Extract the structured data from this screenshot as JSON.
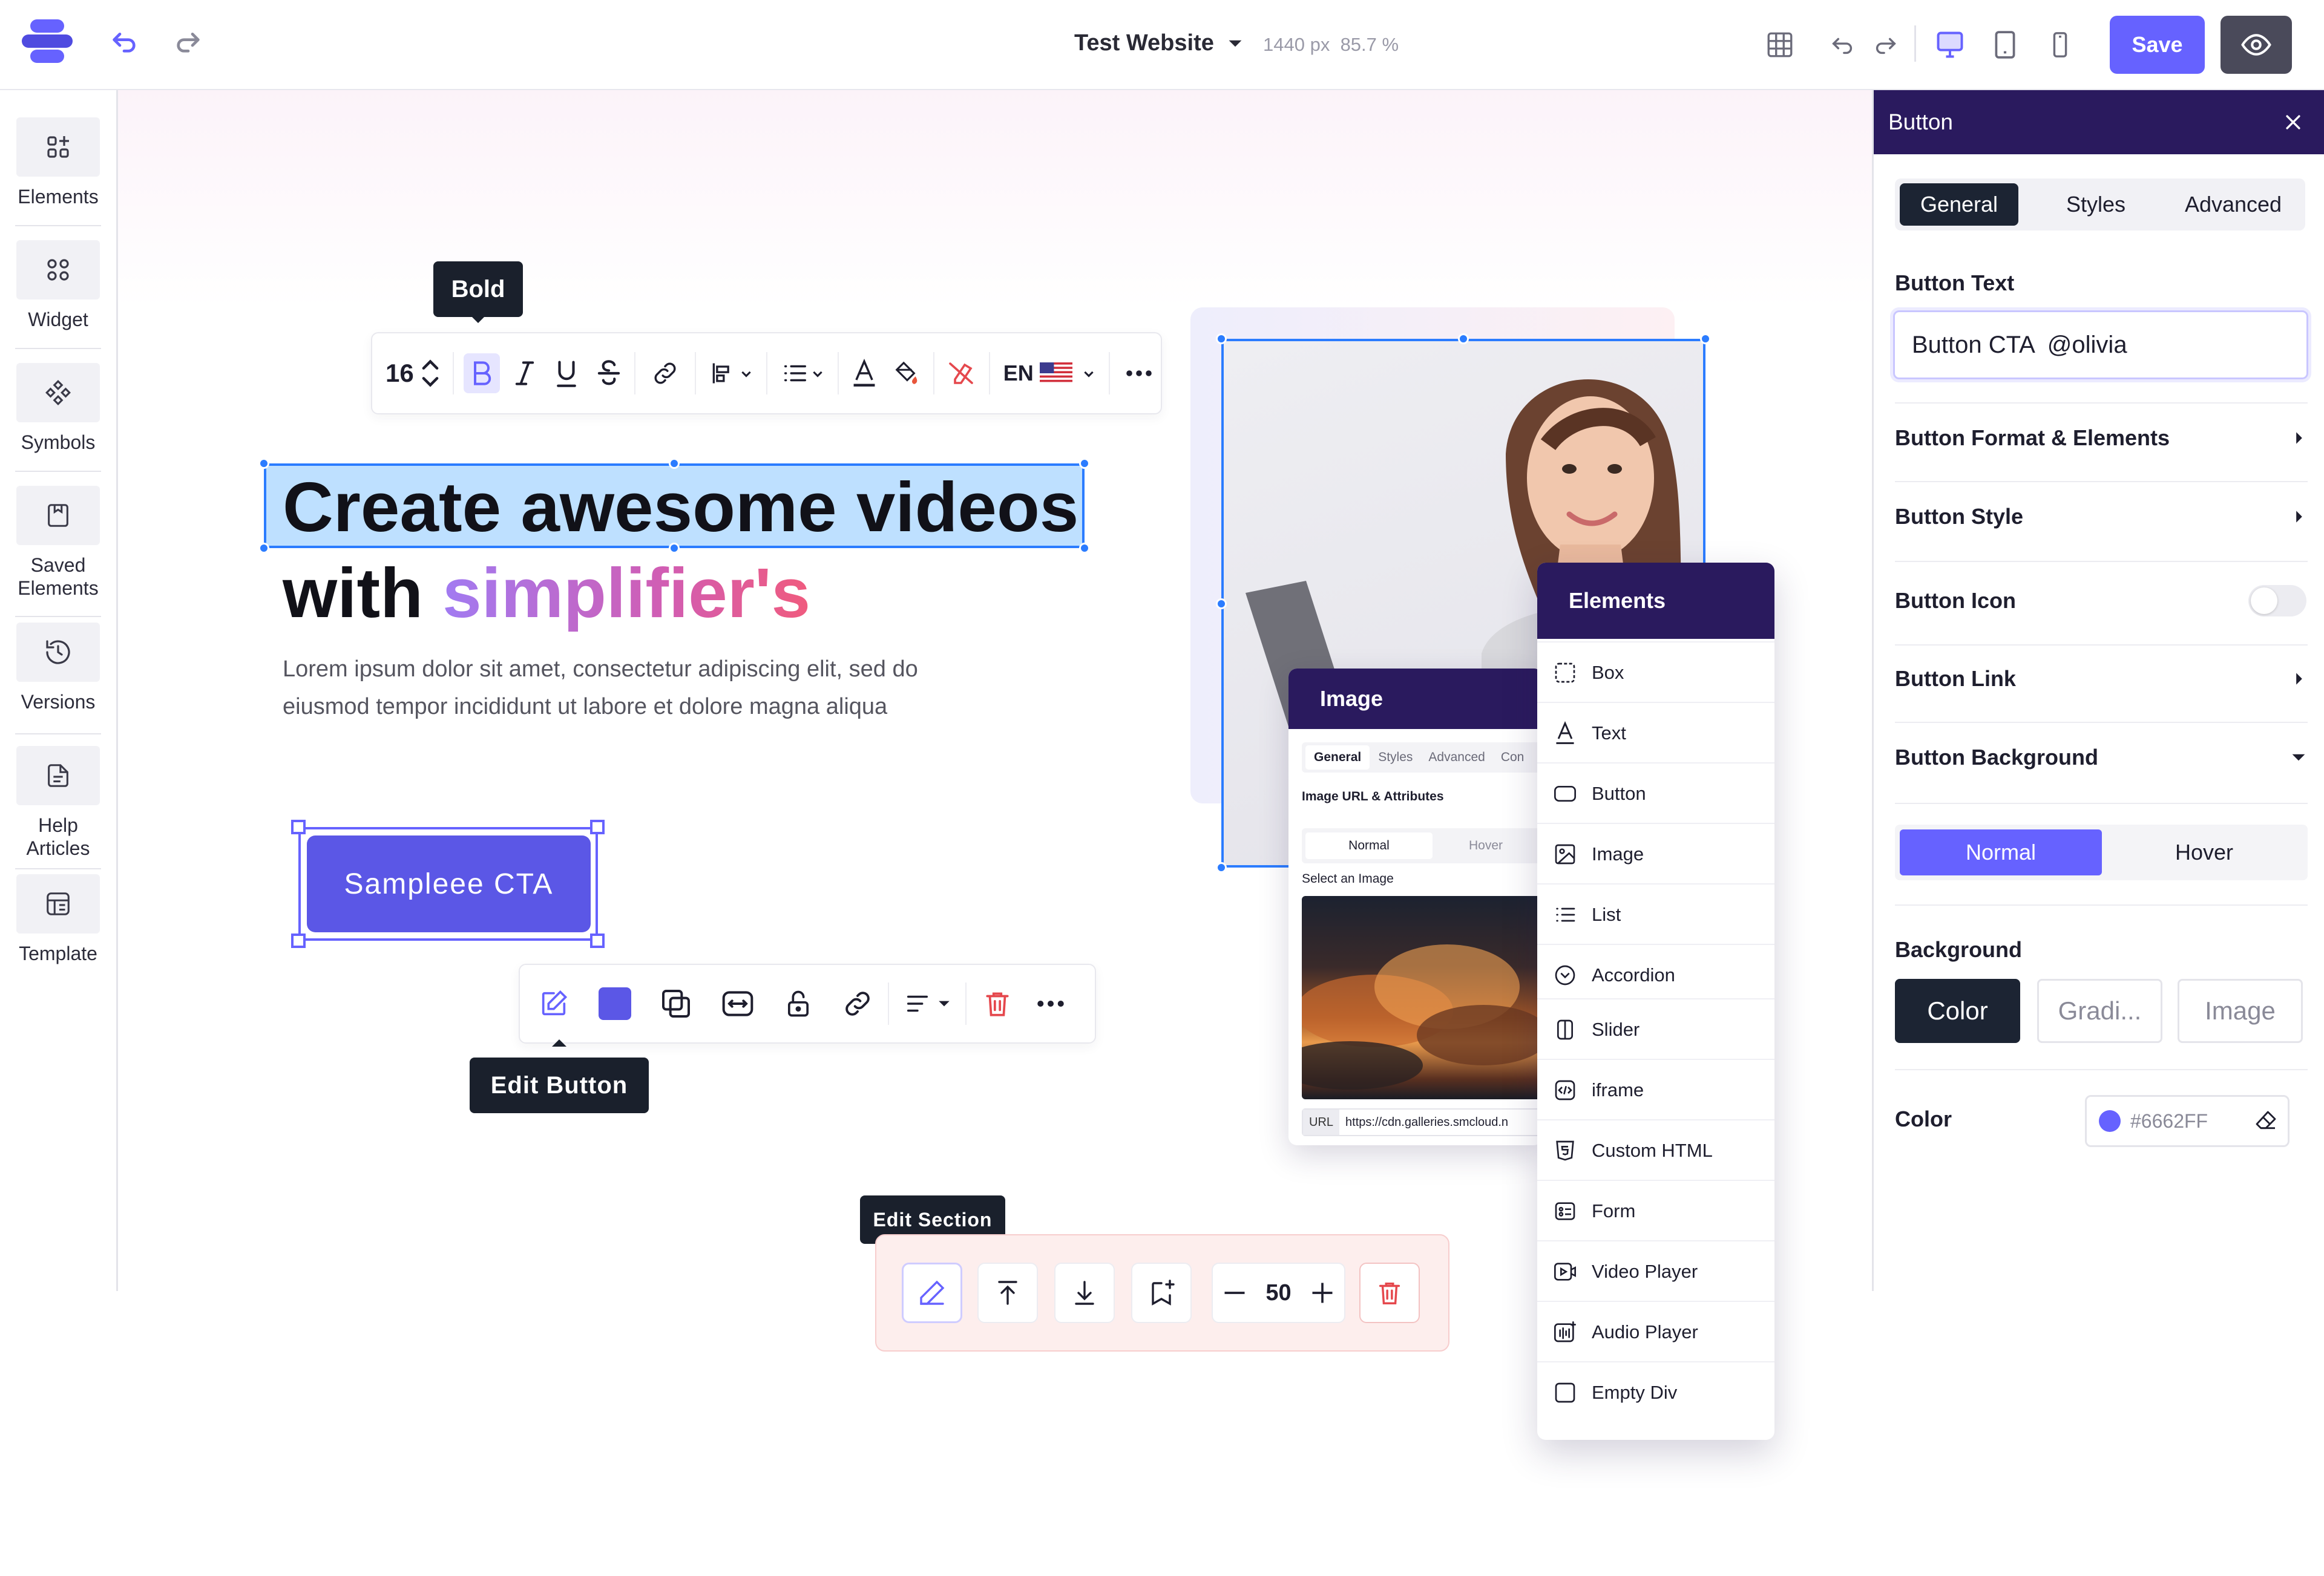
{
  "topbar": {
    "site_name": "Test Website",
    "width_readout": "1440 px",
    "zoom_readout": "85.7 %",
    "save_label": "Save",
    "brand_color": "#6662FF"
  },
  "sidebar": {
    "items": [
      {
        "label": "Elements",
        "icon": "elements-icon"
      },
      {
        "label": "Widget",
        "icon": "widget-icon"
      },
      {
        "label": "Symbols",
        "icon": "symbols-icon"
      },
      {
        "label": "Saved Elements",
        "icon": "saved-elements-icon"
      },
      {
        "label": "Versions",
        "icon": "versions-icon"
      },
      {
        "label": "Help Articles",
        "icon": "help-articles-icon"
      },
      {
        "label": "Template",
        "icon": "template-icon"
      }
    ]
  },
  "text_toolbar": {
    "tooltip": "Bold",
    "font_size": "16",
    "language": "EN"
  },
  "hero": {
    "heading_line1": "Create awesome videos",
    "heading_line2_prefix": "with ",
    "heading_line2_highlight": "simplifier's",
    "body": "Lorem ipsum dolor sit amet, consectetur adipiscing elit, sed do eiusmod tempor incididunt ut labore et dolore magna aliqua",
    "cta_label": "Sampleee CTA"
  },
  "button_toolbar": {
    "tooltip": "Edit Button",
    "swatch_color": "#5B57E6"
  },
  "section_toolbar": {
    "tooltip": "Edit Section",
    "spacing_value": "50"
  },
  "image_panel": {
    "title": "Image",
    "tabs": [
      "General",
      "Styles",
      "Advanced",
      "Con"
    ],
    "section_label": "Image URL & Attributes",
    "states": [
      "Normal",
      "Hover"
    ],
    "select_label": "Select an Image",
    "url_label": "URL",
    "url_value": "https://cdn.galleries.smcloud.n"
  },
  "elements_panel": {
    "title": "Elements",
    "items": [
      {
        "label": "Box",
        "icon": "box-icon"
      },
      {
        "label": "Text",
        "icon": "text-icon"
      },
      {
        "label": "Button",
        "icon": "button-icon"
      },
      {
        "label": "Image",
        "icon": "image-icon"
      },
      {
        "label": "List",
        "icon": "list-icon"
      },
      {
        "label": "Accordion",
        "icon": "accordion-icon"
      },
      {
        "label": "Slider",
        "icon": "slider-icon"
      },
      {
        "label": "iframe",
        "icon": "iframe-icon"
      },
      {
        "label": "Custom HTML",
        "icon": "custom-html-icon"
      },
      {
        "label": "Form",
        "icon": "form-icon"
      },
      {
        "label": "Video Player",
        "icon": "video-player-icon"
      },
      {
        "label": "Audio Player",
        "icon": "audio-player-icon"
      },
      {
        "label": "Empty Div",
        "icon": "empty-div-icon"
      }
    ]
  },
  "right_panel": {
    "title": "Button",
    "tabs": {
      "general": "General",
      "styles": "Styles",
      "advanced": "Advanced"
    },
    "button_text_label": "Button Text",
    "button_text_value": "Button CTA  @olivia",
    "rows": {
      "format": "Button Format & Elements",
      "style": "Button Style",
      "icon": "Button Icon",
      "link": "Button Link",
      "background": "Button Background"
    },
    "states": {
      "normal": "Normal",
      "hover": "Hover"
    },
    "background_label": "Background",
    "bg_types": {
      "color": "Color",
      "gradient": "Gradi...",
      "image": "Image"
    },
    "color_label": "Color",
    "color_value": "#6662FF"
  }
}
